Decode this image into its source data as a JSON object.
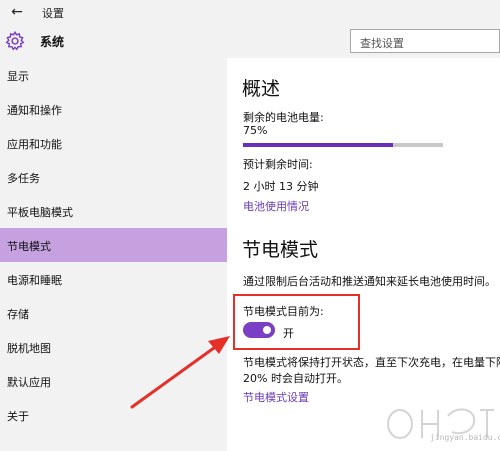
{
  "window": {
    "title": "设置",
    "back_icon": "back-arrow-icon"
  },
  "header": {
    "app_name": "系统",
    "search": {
      "placeholder": "查找设置"
    }
  },
  "sidebar": {
    "items": [
      {
        "label": "显示",
        "selected": false
      },
      {
        "label": "通知和操作",
        "selected": false
      },
      {
        "label": "应用和功能",
        "selected": false
      },
      {
        "label": "多任务",
        "selected": false
      },
      {
        "label": "平板电脑模式",
        "selected": false
      },
      {
        "label": "节电模式",
        "selected": true
      },
      {
        "label": "电源和睡眠",
        "selected": false
      },
      {
        "label": "存储",
        "selected": false
      },
      {
        "label": "脱机地图",
        "selected": false
      },
      {
        "label": "默认应用",
        "selected": false
      },
      {
        "label": "关于",
        "selected": false
      }
    ]
  },
  "main": {
    "overview": {
      "heading": "概述",
      "battery_label": "剩余的电池电量:",
      "battery_value": "75%",
      "battery_percent": 75,
      "remaining_label": "预计剩余时间:",
      "remaining_value": "2 小时 13 分钟",
      "usage_link": "电池使用情况"
    },
    "saver": {
      "heading": "节电模式",
      "description": "通过限制后台活动和推送通知来延长电池使用时间。",
      "status_label": "节电模式目前为:",
      "toggle_state": "开",
      "auto_text_1": "节电模式将保持打开状态，直至下次充电，在电量下降",
      "auto_text_2": "20% 时会自动打开。",
      "settings_link": "节电模式设置"
    }
  },
  "watermark": {
    "text": "jingyan.baidu.com"
  },
  "colors": {
    "accent": "#6a2fb8",
    "selected_nav": "#c5a1e0",
    "annotation": "#e5302a"
  }
}
